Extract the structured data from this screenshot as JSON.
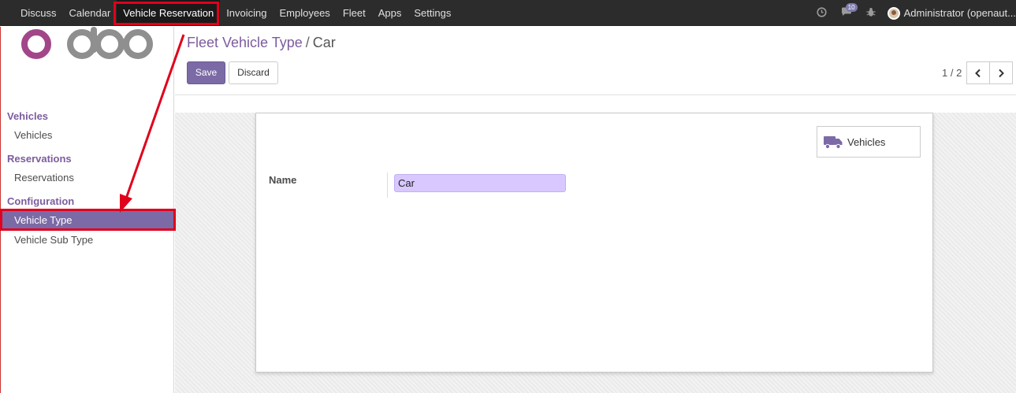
{
  "topbar": {
    "menu": [
      "Discuss",
      "Calendar",
      "Vehicle Reservation",
      "Invoicing",
      "Employees",
      "Fleet",
      "Apps",
      "Settings"
    ],
    "active_index": 2,
    "chat_count": "10",
    "user": "Administrator (openaut..."
  },
  "sidebar": {
    "sections": [
      {
        "title": "Vehicles",
        "items": [
          "Vehicles"
        ]
      },
      {
        "title": "Reservations",
        "items": [
          "Reservations"
        ]
      },
      {
        "title": "Configuration",
        "items": [
          "Vehicle Type",
          "Vehicle Sub Type"
        ]
      }
    ],
    "active_item": "Vehicle Type"
  },
  "breadcrumb": {
    "parent": "Fleet Vehicle Type",
    "separator": "/",
    "current": "Car"
  },
  "buttons": {
    "save": "Save",
    "discard": "Discard"
  },
  "pager": {
    "text": "1 / 2"
  },
  "form": {
    "smart_button": "Vehicles",
    "name_label": "Name",
    "name_value": "Car"
  },
  "colors": {
    "accent": "#7c6aa6",
    "highlight": "#e0001b",
    "input_bg": "#d8c8ff"
  },
  "icons": [
    "clock-icon",
    "chat-icon",
    "bug-icon",
    "chevron-left-icon",
    "chevron-right-icon",
    "truck-icon"
  ]
}
